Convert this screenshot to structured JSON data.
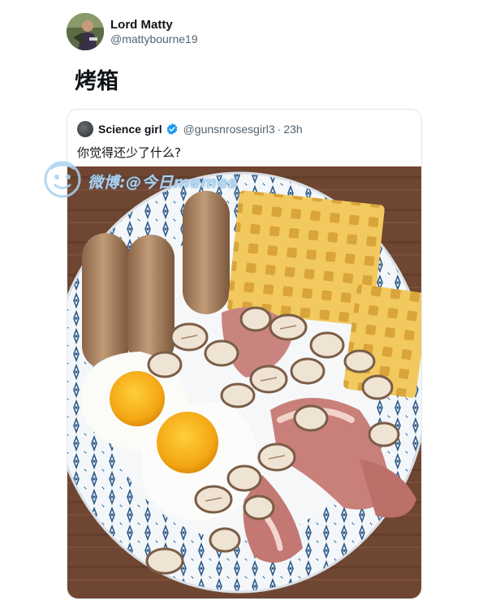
{
  "tweet": {
    "author": {
      "display_name": "Lord Matty",
      "handle": "@mattybourne19",
      "avatar_icon": "profile-photo"
    },
    "text": "烤箱",
    "quoted_tweet": {
      "author": {
        "display_name": "Science girl",
        "handle": "@gunsnrosesgirl3",
        "verified": true,
        "verified_color": "#1d9bf0"
      },
      "separator": "·",
      "time": "23h",
      "text": "你觉得还少了什么?",
      "media": {
        "description_icon": "breakfast-plate-photo"
      }
    }
  },
  "watermark": {
    "text": "微博:@今日memes",
    "logo_icon": "weibo-mascot-icon"
  },
  "colors": {
    "text_primary": "#0f1419",
    "text_secondary": "#536471",
    "border": "#e1e6ea",
    "verified": "#1d9bf0"
  }
}
